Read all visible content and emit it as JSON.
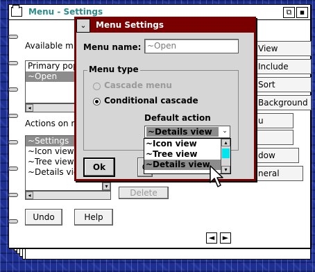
{
  "notebook": {
    "title": "Menu - Settings",
    "restore_glyph": "⧉",
    "close_glyph": "▪",
    "available_label": "Available m",
    "available_items": [
      "Primary pop",
      "~Open"
    ],
    "actions_label": "Actions on m",
    "action_items": [
      "~Settings",
      "~Icon view",
      "~Tree view",
      "~Details vie"
    ],
    "delete_label": "Delete",
    "undo_label": "Undo",
    "help_label": "Help",
    "right_buttons": [
      "View",
      "Include",
      "Sort",
      "Background",
      "u",
      "",
      "dow",
      "neral"
    ],
    "prev_arrow": "◄",
    "next_arrow": "►"
  },
  "dialog": {
    "title": "Menu Settings",
    "sys_glyph": "⌄",
    "menu_name_label": "Menu name:",
    "menu_name_value": "~Open",
    "menu_type_label": "Menu type",
    "cascade_label": "Cascade menu",
    "conditional_label": "Conditional cascade",
    "default_action_label": "Default action",
    "default_action_value": "~Details view",
    "dropdown_glyph": "⌄",
    "dropdown_items": [
      "~Icon view",
      "~Tree view",
      "~Details view"
    ],
    "ok_label": "Ok",
    "cancel_partial": "C"
  },
  "colors": {
    "desktop": "#1f2f8f",
    "dialog_frame": "#7a0000",
    "notebook_title": "#2e8b8b",
    "selection": "#8c8c8c",
    "scroll_thumb": "#00e5ee"
  }
}
